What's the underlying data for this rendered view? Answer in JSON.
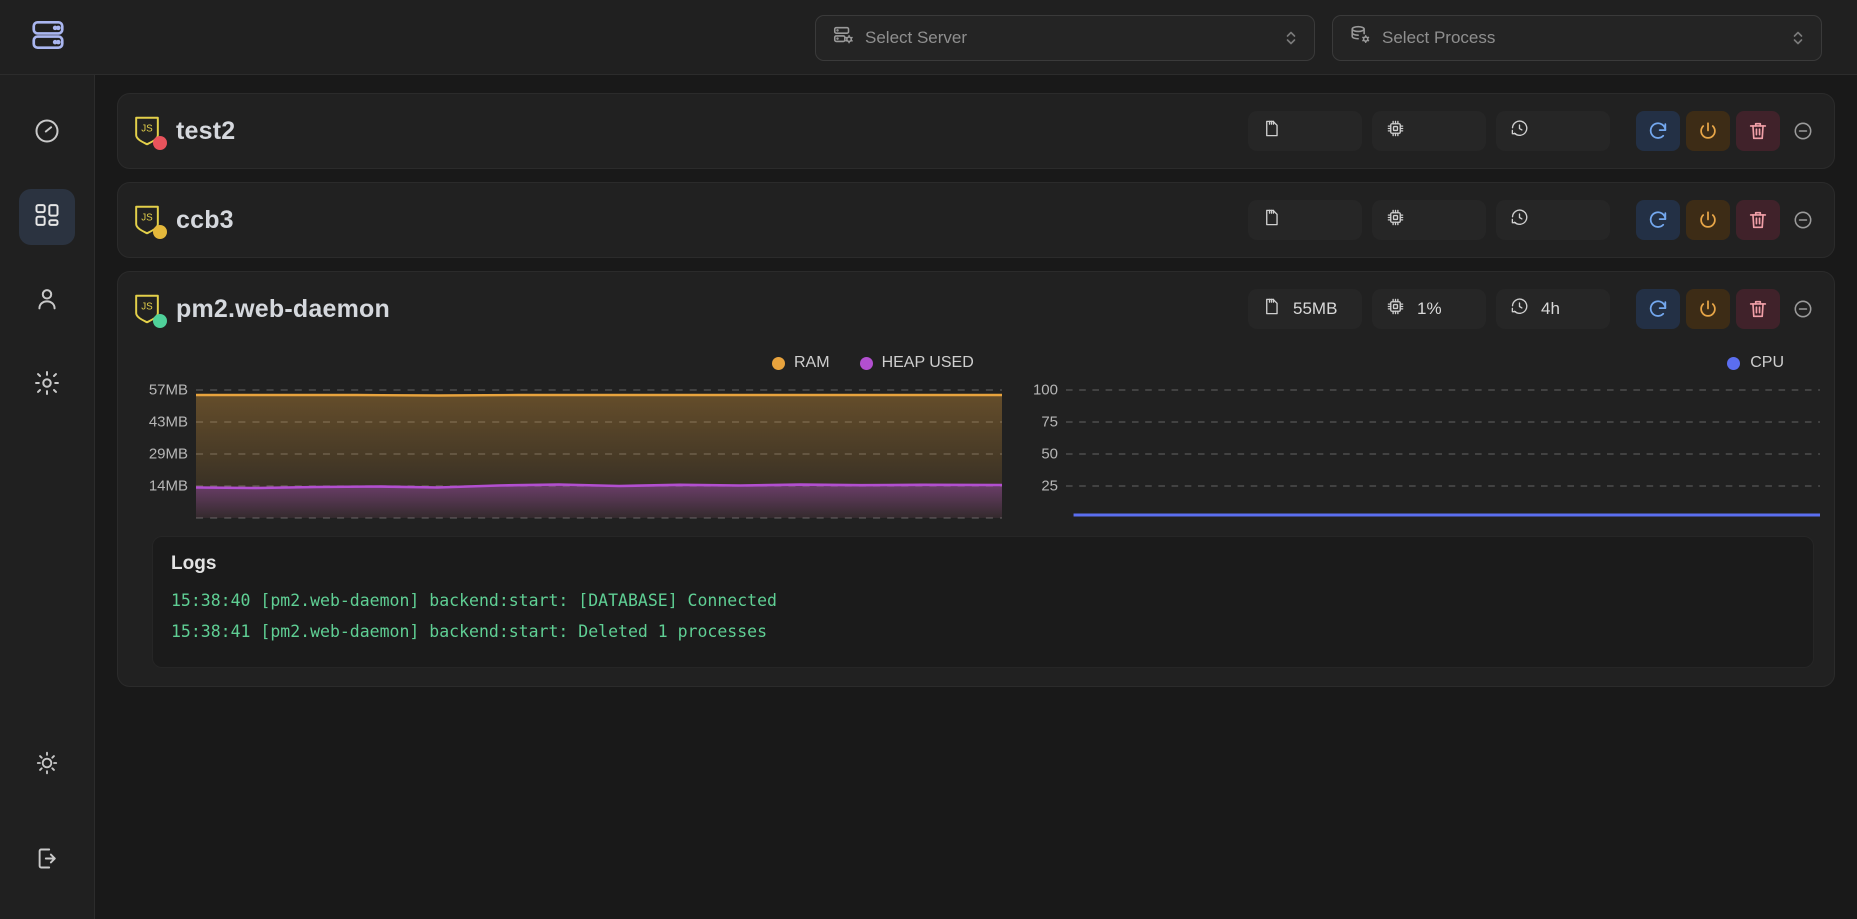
{
  "app": {
    "logo_icon": "server-stack-icon",
    "background": "#191919"
  },
  "topbar": {
    "server_select": {
      "icon": "server-cog-icon",
      "placeholder": "Select Server",
      "value": "",
      "chevron_icon": "chevron-up-down-icon"
    },
    "process_select": {
      "icon": "database-cog-icon",
      "placeholder": "Select Process",
      "value": "",
      "chevron_icon": "chevron-up-down-icon"
    }
  },
  "sidebar": {
    "items": [
      {
        "name": "dashboard-gauge",
        "icon": "gauge-icon",
        "active": false
      },
      {
        "name": "processes",
        "icon": "layout-grid-icon",
        "active": true
      },
      {
        "name": "users",
        "icon": "user-icon",
        "active": false
      },
      {
        "name": "settings",
        "icon": "gear-icon",
        "active": false
      }
    ],
    "bottom_items": [
      {
        "name": "theme-toggle",
        "icon": "sun-icon"
      },
      {
        "name": "logout",
        "icon": "logout-icon"
      }
    ]
  },
  "processes": [
    {
      "name": "test2",
      "runtime_icon": "js-icon",
      "status": "errored",
      "status_color": "#e8535c",
      "memory": "",
      "cpu": "",
      "uptime": "",
      "expanded": false
    },
    {
      "name": "ccb3",
      "runtime_icon": "js-icon",
      "status": "stopped",
      "status_color": "#e4b83b",
      "memory": "",
      "cpu": "",
      "uptime": "",
      "expanded": false
    },
    {
      "name": "pm2.web-daemon",
      "runtime_icon": "js-icon",
      "status": "online",
      "status_color": "#4fd19a",
      "memory": "55MB",
      "cpu": "1%",
      "uptime": "4h",
      "expanded": true
    }
  ],
  "chip_icons": {
    "memory": "memory-card-icon",
    "cpu": "cpu-chip-icon",
    "uptime": "clock-history-icon"
  },
  "actions": {
    "restart": {
      "label": "restart",
      "icon": "refresh-icon",
      "color": "#74a8ef"
    },
    "power": {
      "label": "stop",
      "icon": "power-icon",
      "color": "#e8a648"
    },
    "delete": {
      "label": "delete",
      "icon": "trash-icon",
      "color": "#f2a0a8"
    },
    "collapse": {
      "label": "collapse",
      "icon": "minus-circle-icon",
      "color": "#9a9a9a"
    }
  },
  "chart_data": [
    {
      "type": "area",
      "name": "memory-chart",
      "title": "",
      "legend": [
        {
          "label": "RAM",
          "color": "#e8a33d"
        },
        {
          "label": "HEAP USED",
          "color": "#b24fd0"
        }
      ],
      "legend_position": "top-center",
      "grid": true,
      "ylabel": "",
      "xlabel": "",
      "ytick_labels": [
        "57MB",
        "43MB",
        "29MB",
        "14MB"
      ],
      "ytick_values": [
        57,
        43,
        29,
        14
      ],
      "ylim": [
        0,
        62
      ],
      "series": [
        {
          "name": "RAM",
          "color": "#e8a33d",
          "values": [
            56,
            56,
            56,
            56,
            56,
            56,
            56,
            56,
            56,
            55.8,
            55.9,
            56,
            56,
            56,
            56,
            56,
            56,
            56,
            56,
            56,
            56,
            56,
            56,
            56,
            56
          ]
        },
        {
          "name": "HEAP USED",
          "color": "#b24fd0",
          "values": [
            13.5,
            13.4,
            13.5,
            13.6,
            13.5,
            13.4,
            13.6,
            13.8,
            13.6,
            13.5,
            13.9,
            14.1,
            13.8,
            14.2,
            14.0,
            13.9,
            14.1,
            13.8,
            14.0,
            13.9,
            14.1,
            14.0,
            13.9,
            14.0,
            14.0
          ]
        }
      ]
    },
    {
      "type": "line",
      "name": "cpu-chart",
      "title": "",
      "legend": [
        {
          "label": "CPU",
          "color": "#5b6ef0"
        }
      ],
      "legend_position": "top-right",
      "grid": true,
      "ylabel": "",
      "xlabel": "",
      "ytick_labels": [
        "100",
        "75",
        "50",
        "25"
      ],
      "ytick_values": [
        100,
        75,
        50,
        25
      ],
      "ylim": [
        0,
        112
      ],
      "series": [
        {
          "name": "CPU",
          "color": "#5b6ef0",
          "values": [
            1,
            1,
            1,
            1,
            1,
            1,
            1,
            1,
            1,
            1,
            1,
            1,
            1,
            1,
            1,
            1,
            1,
            1,
            1,
            1,
            1
          ]
        }
      ]
    }
  ],
  "logs": {
    "title": "Logs",
    "lines": [
      "15:38:40 [pm2.web-daemon] backend:start: [DATABASE] Connected",
      "15:38:41 [pm2.web-daemon] backend:start: Deleted 1 processes"
    ],
    "text_color": "#5fcf94"
  }
}
